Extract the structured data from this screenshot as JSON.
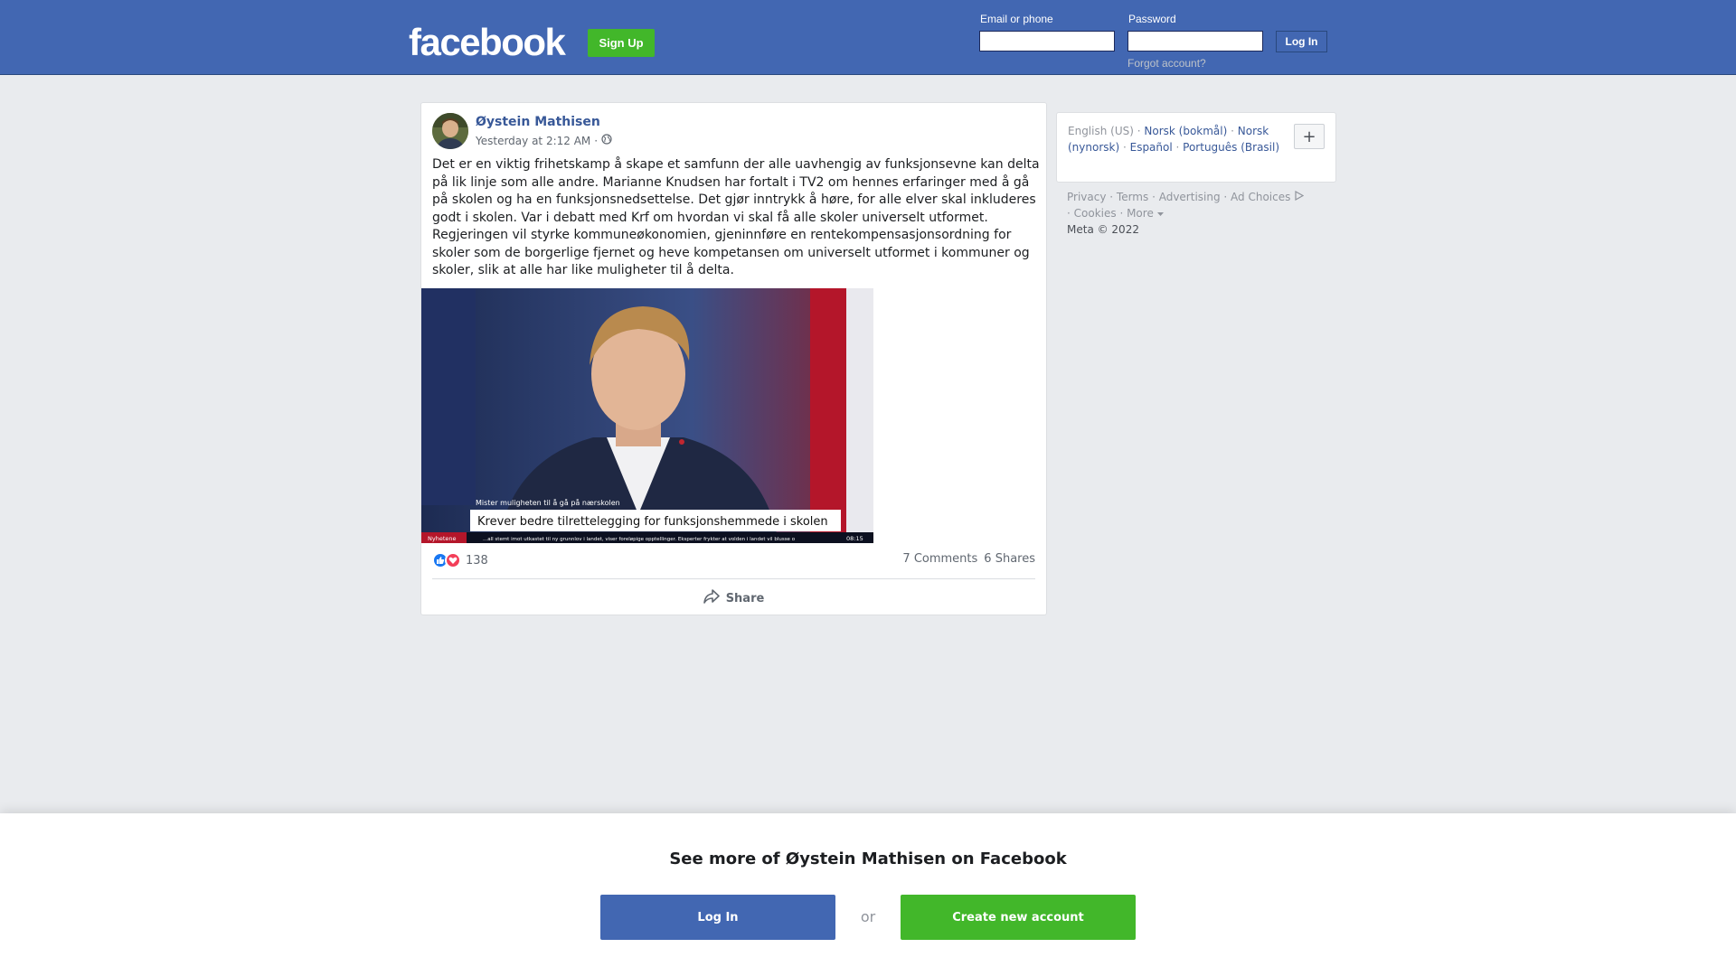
{
  "header": {
    "logo": "facebook",
    "signup_label": "Sign Up",
    "email_label": "Email or phone",
    "password_label": "Password",
    "login_label": "Log In",
    "forgot_label": "Forgot account?"
  },
  "post": {
    "author": "Øystein Mathisen",
    "timestamp": "Yesterday at 2:12 AM",
    "separator": "·",
    "privacy_icon": "globe-icon",
    "text": "Det er en viktig frihetskamp å skape et samfunn der alle uavhengig av funksjonsevne kan delta på lik linje som alle andre. Marianne Knudsen har fortalt i TV2 om hennes erfaringer med å gå på skolen og ha en funksjonsnedsettelse. Det gjør inntrykk å høre, for alle elver skal inkluderes godt i skolen. Var i debatt med Krf om hvordan vi skal få alle skoler universelt utformet. Regjeringen vil styrke kommuneøkonomien, gjeninnføre en rentekompensasjonsordning for skoler som de borgerlige fjernet og heve kompetansen om universelt utformet i kommuner og skoler, slik at alle har like muligheter til å delta.",
    "image": {
      "small_caption": "Mister muligheten til å gå på nærskolen",
      "headline": "Krever bedre tilrettelegging for funksjonshemmede i skolen",
      "ticker": "...all stemt imot utkastet til ny grunnlov i landet, viser foreløpige opptellinger. Eksperter frykter at volden i landet vil blusse o",
      "channel": "Nyhetene",
      "clock": "08:15"
    },
    "reaction_count": "138",
    "comments": "7 Comments",
    "shares": "6 Shares",
    "share_label": "Share"
  },
  "sidebar": {
    "current_language": "English (US)",
    "languages": [
      "Norsk (bokmål)",
      "Norsk (nynorsk)",
      "Español",
      "Português (Brasil)"
    ],
    "plus_label": "+",
    "footer_links": [
      "Privacy",
      "Terms",
      "Advertising",
      "Ad Choices",
      "Cookies",
      "More"
    ],
    "copyright": "Meta © 2022"
  },
  "banner": {
    "title": "See more of Øystein Mathisen on Facebook",
    "login_label": "Log In",
    "or_label": "or",
    "create_label": "Create new account"
  },
  "colors": {
    "brand_blue": "#4267b2",
    "link_blue": "#385898",
    "green": "#42b72a",
    "background": "#e9ebee"
  }
}
